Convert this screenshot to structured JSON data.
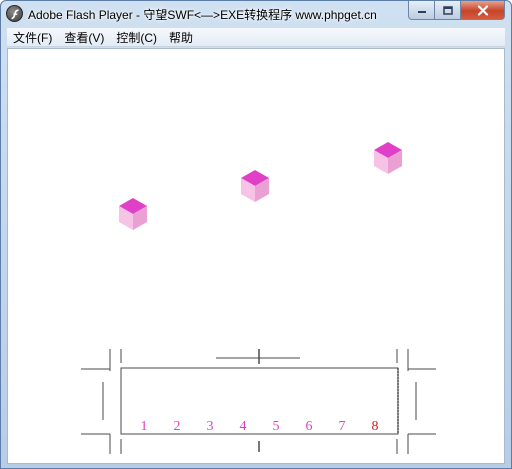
{
  "window": {
    "title": "Adobe Flash Player - 守望SWF<—>EXE转换程序 www.phpget.cn"
  },
  "menu": {
    "items": [
      "文件(F)",
      "查看(V)",
      "控制(C)",
      "帮助"
    ]
  },
  "game": {
    "cube_colors": {
      "top": "#e040c8",
      "left": "#f6c3e6",
      "right": "#eba0d4"
    },
    "slot_labels": [
      {
        "text": "1",
        "color": "#e040c8"
      },
      {
        "text": "2",
        "color": "#e040c8"
      },
      {
        "text": "3",
        "color": "#e040c8"
      },
      {
        "text": "4",
        "color": "#cc3fbf"
      },
      {
        "text": "5",
        "color": "#e040c8"
      },
      {
        "text": "6",
        "color": "#e040c8"
      },
      {
        "text": "7",
        "color": "#e040c8"
      },
      {
        "text": "8",
        "color": "#e01818"
      }
    ]
  }
}
